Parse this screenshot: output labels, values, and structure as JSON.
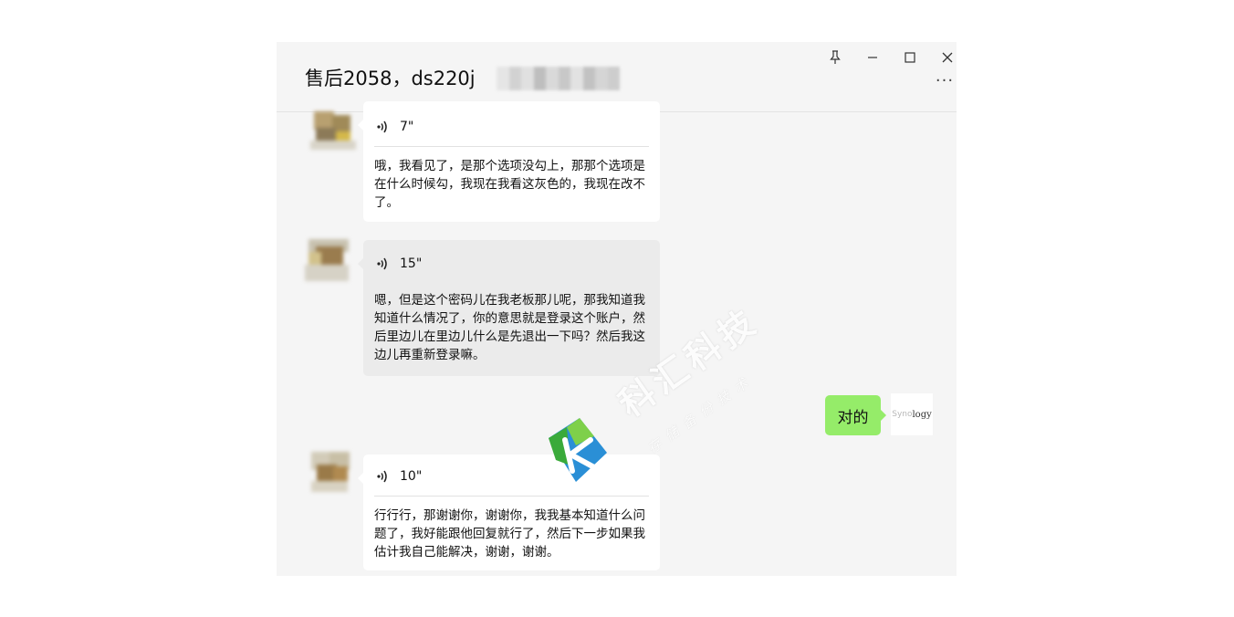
{
  "window": {
    "title": "售后2058，ds220j",
    "more_label": "···"
  },
  "messages": [
    {
      "duration": "7\"",
      "text": "哦，我看见了，是那个选项没勾上，那那个选项是在什么时候勾，我现在我看这灰色的，我现在改不了。"
    },
    {
      "duration": "15\"",
      "text": "嗯，但是这个密码儿在我老板那儿呢，那我知道我知道什么情况了，你的意思就是登录这个账户，然后里边儿在里边儿什么是先退出一下吗？然后我这边儿再重新登录嘛。"
    },
    {
      "text": "对的",
      "avatar_brand": "Synology",
      "avatar_brand_parts": [
        "Syno",
        "logy"
      ]
    },
    {
      "duration": "10\"",
      "text": "行行行，那谢谢你，谢谢你，我我基本知道什么问题了，我好能跟他回复就行了，然后下一步如果我估计我自己能解决，谢谢，谢谢。"
    }
  ],
  "watermark": {
    "title": "科汇科技",
    "subtitle": "存储备份技术"
  },
  "colors": {
    "window_bg": "#f5f5f5",
    "self_bubble": "#95ec69",
    "other_bubble": "#ffffff",
    "other_bubble_selected": "#ebebeb"
  }
}
